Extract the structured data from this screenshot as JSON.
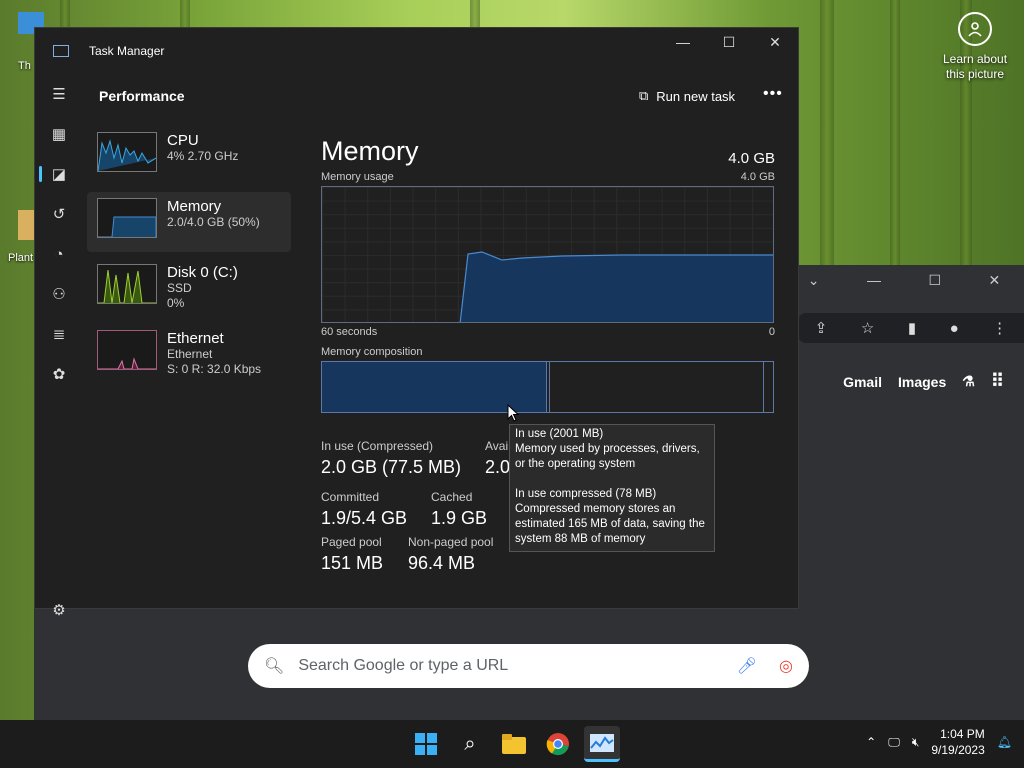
{
  "desktop": {
    "icon1_label": "Th",
    "icon2_label": "Plant",
    "learn_about": "Learn about this picture"
  },
  "browser": {
    "gmail": "Gmail",
    "images": "Images",
    "search_placeholder": "Search Google or type a URL"
  },
  "task_manager": {
    "title": "Task Manager",
    "header": "Performance",
    "run_new_task": "Run new task",
    "perf_items": [
      {
        "name": "CPU",
        "sub1": "4% 2.70 GHz",
        "sub2": ""
      },
      {
        "name": "Memory",
        "sub1": "2.0/4.0 GB (50%)",
        "sub2": ""
      },
      {
        "name": "Disk 0 (C:)",
        "sub1": "SSD",
        "sub2": "0%"
      },
      {
        "name": "Ethernet",
        "sub1": "Ethernet",
        "sub2": "S: 0 R: 32.0 Kbps"
      }
    ],
    "memory": {
      "title": "Memory",
      "total": "4.0 GB",
      "usage_label": "Memory usage",
      "usage_max": "4.0 GB",
      "time_left": "60 seconds",
      "time_right": "0",
      "composition_label": "Memory composition",
      "stats": {
        "in_use_label": "In use (Compressed)",
        "in_use_value": "2.0 GB (77.5 MB)",
        "available_label": "Avai",
        "available_value": "2.0",
        "committed_label": "Committed",
        "committed_value": "1.9/5.4 GB",
        "cached_label": "Cached",
        "cached_value": "1.9 GB",
        "paged_label": "Paged pool",
        "paged_value": "151 MB",
        "nonpaged_label": "Non-paged pool",
        "nonpaged_value": "96.4 MB"
      }
    },
    "tooltip": {
      "line1": "In use (2001 MB)",
      "line2": "Memory used by processes, drivers, or the operating system",
      "line3": "In use compressed (78 MB)",
      "line4": "Compressed memory stores an estimated 165 MB of data, saving the system 88 MB of memory"
    }
  },
  "taskbar": {
    "time": "1:04 PM",
    "date": "9/19/2023"
  }
}
